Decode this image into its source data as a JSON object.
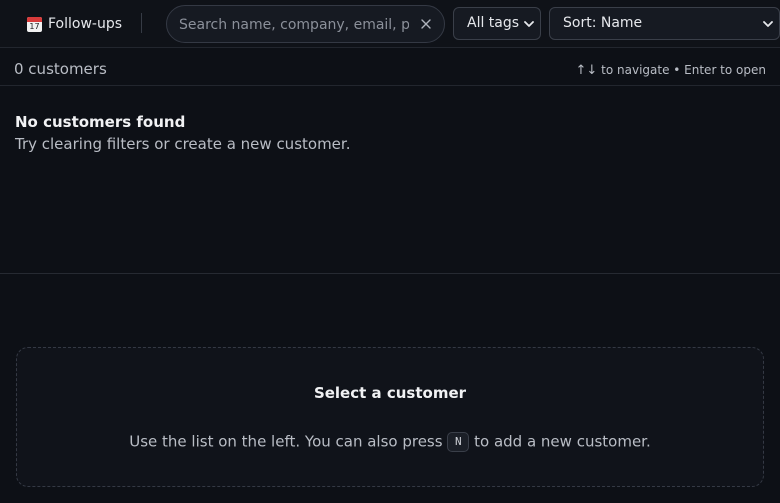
{
  "toolbar": {
    "followups_label": "Follow-ups",
    "followups_icon_text": "17",
    "search_placeholder": "Search name, company, email, p",
    "search_value": "",
    "tags_select_value": "All tags",
    "sort_select_value": "Sort: Name"
  },
  "list": {
    "count_text": "0 customers",
    "hint_arrows": "↑↓",
    "hint_text": "to navigate • Enter to open",
    "empty_title": "No customers found",
    "empty_subtitle": "Try clearing filters or create a new customer."
  },
  "detail": {
    "title": "Select a customer",
    "body_before": "Use the list on the left. You can also press",
    "key": "N",
    "body_after": "to add a new customer."
  },
  "colors": {
    "background": "#0d1016",
    "calendar_red": "#d93b3b"
  },
  "icons": {
    "followups": "calendar-icon",
    "clear": "close-icon",
    "dropdown": "chevron-down-icon"
  }
}
